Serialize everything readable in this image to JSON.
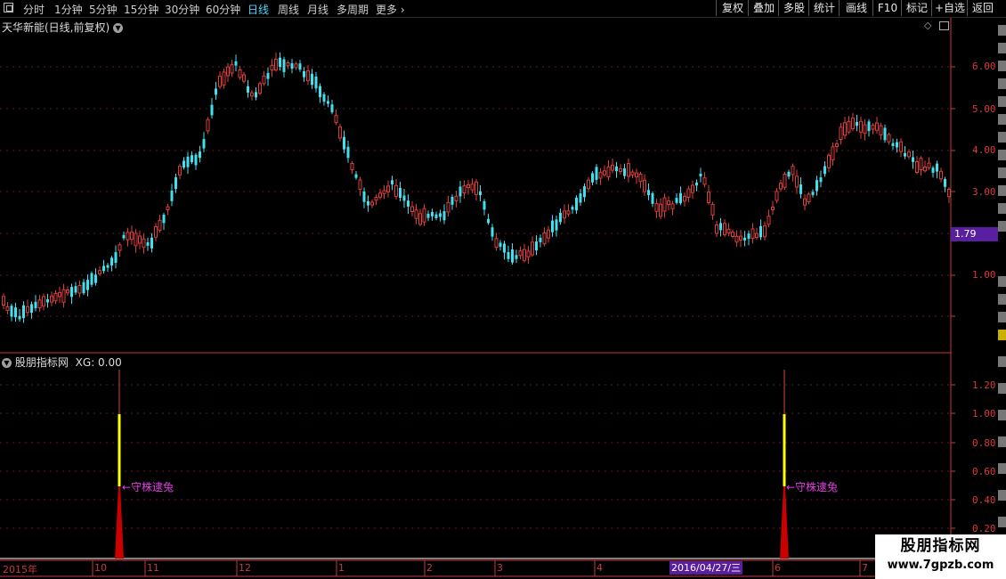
{
  "toolbar": {
    "periods": [
      "分时",
      "1分钟",
      "5分钟",
      "15分钟",
      "30分钟",
      "60分钟",
      "日线",
      "周线",
      "月线",
      "多周期",
      "更多"
    ],
    "active_period": "日线",
    "more_arrow": "›",
    "buttons": [
      "复权",
      "叠加",
      "多股",
      "统计",
      "画线",
      "F10",
      "标记",
      "+自选",
      "返回"
    ]
  },
  "main_panel": {
    "title": "天华新能(日线,前复权)",
    "y_axis_labels": [
      "6.00",
      "5.00",
      "4.00",
      "3.00",
      "1.00"
    ],
    "last_price": "1.79"
  },
  "indicator_panel": {
    "title": "股朋指标网",
    "xg_label": "XG: 0.00",
    "y_axis_labels": [
      "1.20",
      "1.00",
      "0.80",
      "0.60",
      "0.40",
      "0.20"
    ],
    "annotation": "←守株逮兔",
    "spike_values": [
      1,
      1
    ]
  },
  "date_axis": {
    "labels": [
      "2015年",
      "10",
      "11",
      "12",
      "1",
      "2",
      "3",
      "4",
      "6",
      "7"
    ],
    "selected_date": "2016/04/27/三"
  },
  "colors": {
    "up": "#e23b3b",
    "down": "#3fe0f0",
    "axis": "#c83a3a",
    "spike_yellow": "#ffff00",
    "annotation": "#e040e0",
    "highlight": "#5a1fa0"
  },
  "watermark": {
    "title": "股朋指标网",
    "url": "www.7gpzb.com"
  }
}
